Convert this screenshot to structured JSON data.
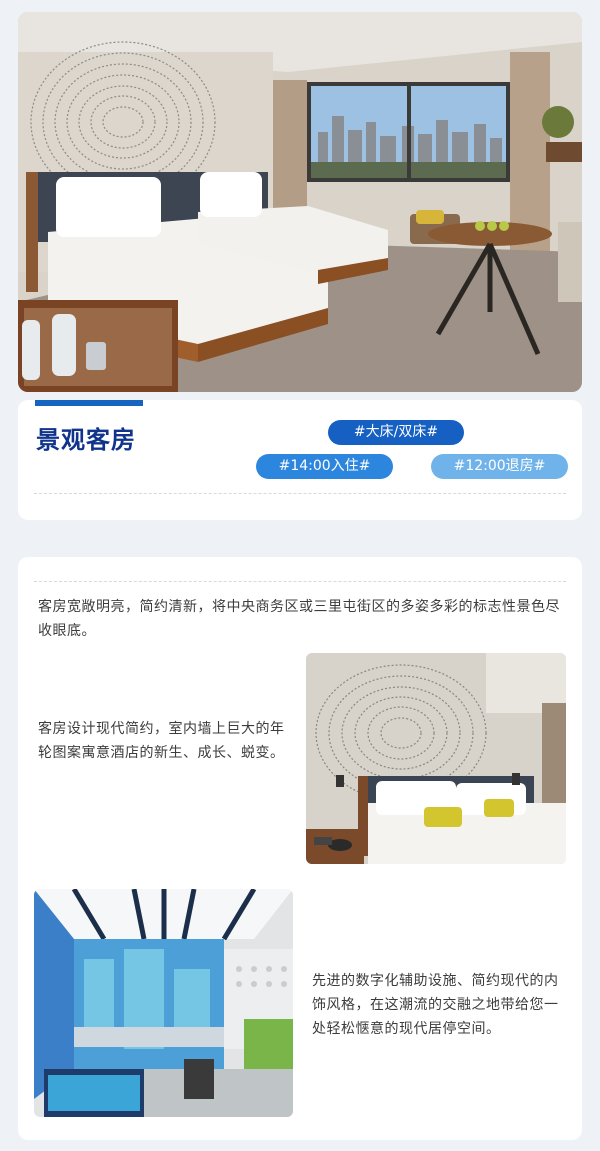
{
  "room": {
    "title": "景观客房",
    "tags": {
      "bed": "#大床/双床#",
      "checkin": "#14:00入住#",
      "checkout": "#12:00退房#"
    }
  },
  "content": {
    "paragraph_1": "客房宽敞明亮，简约清新，将中央商务区或三里屯街区的多姿多彩的标志性景色尽收眼底。",
    "paragraph_2": "客房设计现代简约，室内墙上巨大的年轮图案寓意酒店的新生、成长、蜕变。",
    "paragraph_3": "先进的数字化辅助设施、简约现代的内饰风格，在这潮流的交融之地带给您一处轻松惬意的现代居停空间。"
  },
  "colors": {
    "accent": "#1565c0",
    "title": "#10348c",
    "tag_bed": "#1560c2",
    "tag_checkin": "#2d86de",
    "tag_checkout": "#6fb3ea"
  }
}
